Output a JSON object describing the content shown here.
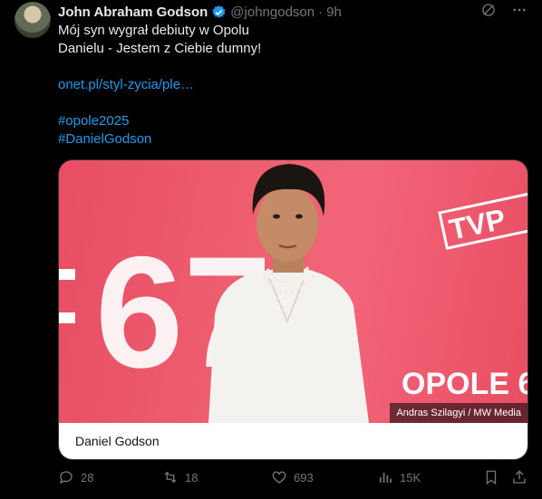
{
  "tweet": {
    "author_name": "John Abraham Godson",
    "handle": "@johngodson",
    "separator": "·",
    "time": "9h",
    "lines": [
      "Mój syn wygrał debiuty w Opolu",
      "Danielu - Jestem z Ciebie dumny!",
      "",
      "onet.pl/styl-zycia/ple…",
      "",
      "#opole2025",
      "#DanielGodson"
    ]
  },
  "card": {
    "photo_credit": "Andras Szilagyi / MW Media",
    "caption": "Daniel Godson"
  },
  "image_text": {
    "tvp": "TVP",
    "opole": "OPOLE 6",
    "big_number": "67"
  },
  "actions": {
    "replies": "28",
    "reposts": "18",
    "likes": "693",
    "views": "15K"
  },
  "colors": {
    "link": "#1d9bf0",
    "muted": "#71767b",
    "verified": "#1d9bf0",
    "photo_background": "#ee5f70"
  }
}
